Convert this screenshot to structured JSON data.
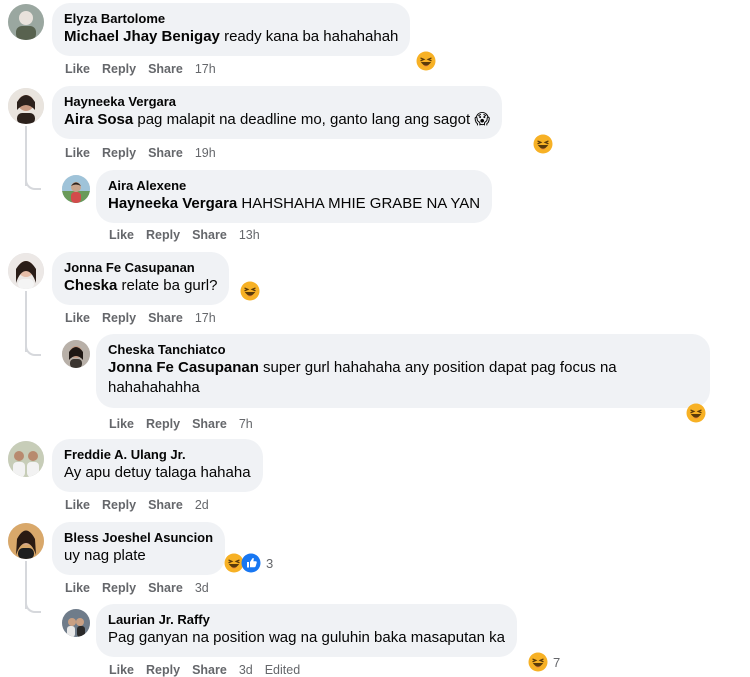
{
  "actions": {
    "like": "Like",
    "reply": "Reply",
    "share": "Share",
    "edited": "Edited"
  },
  "comments": [
    {
      "author": "Elyza Bartolome",
      "mention": "Michael Jhay Benigay",
      "text": " ready kana ba hahahahah",
      "time": "17h"
    },
    {
      "author": "Hayneeka Vergara",
      "mention": "Aira Sosa",
      "text": " pag malapit na deadline mo, ganto lang ang sagot 😱",
      "time": "19h"
    },
    {
      "author": "Aira Alexene",
      "mention": "Hayneeka Vergara",
      "text": " HAHSHAHA MHIE GRABE NA YAN",
      "time": "13h"
    },
    {
      "author": "Jonna Fe Casupanan",
      "mention": "Cheska",
      "text": " relate ba gurl?",
      "time": "17h"
    },
    {
      "author": "Cheska Tanchiatco",
      "mention": "Jonna Fe Casupanan",
      "text": " super gurl hahahaha any position dapat pag focus na hahahahahha",
      "time": "7h"
    },
    {
      "author": "Freddie A. Ulang Jr.",
      "mention": "",
      "text": "Ay apu detuy talaga hahaha",
      "time": "2d"
    },
    {
      "author": "Bless Joeshel Asuncion",
      "mention": "",
      "text": "uy nag plate",
      "time": "3d",
      "reaction_count": "3"
    },
    {
      "author": "Laurian Jr. Raffy",
      "mention": "",
      "text": "Pag ganyan na position wag na guluhin baka masaputan ka",
      "time": "3d",
      "reaction_count": "7"
    }
  ],
  "colors": {
    "bubble": "#f0f2f5",
    "meta": "#65676b",
    "haha": "#f7b125",
    "like": "#1877f2"
  },
  "icons": {
    "haha": "haha-reaction-icon",
    "like": "like-reaction-icon"
  }
}
